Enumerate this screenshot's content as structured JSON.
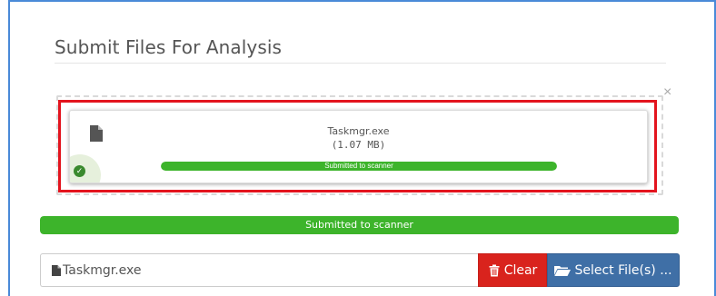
{
  "page": {
    "title": "Submit Files For Analysis"
  },
  "dropzone": {
    "close_label": "×"
  },
  "file_card": {
    "file_name": "Taskmgr.exe",
    "file_size": "(1.07 MB)",
    "progress_label": "Submitted to scanner",
    "progress_fraction": 1.0,
    "status_icon": "check-circle-icon",
    "file_icon": "file-icon"
  },
  "overall_progress": {
    "label": "Submitted to scanner",
    "fraction": 1.0
  },
  "file_input": {
    "value": "Taskmgr.exe",
    "icon": "file-icon"
  },
  "buttons": {
    "clear_label": "Clear",
    "clear_icon": "trash-icon",
    "select_label": "Select File(s) ...",
    "select_icon": "folder-open-icon"
  },
  "colors": {
    "frame_border": "#4a8ad8",
    "highlight": "#e3141e",
    "success": "#3db42b",
    "danger": "#d9231d",
    "primary": "#3f6fa6"
  }
}
